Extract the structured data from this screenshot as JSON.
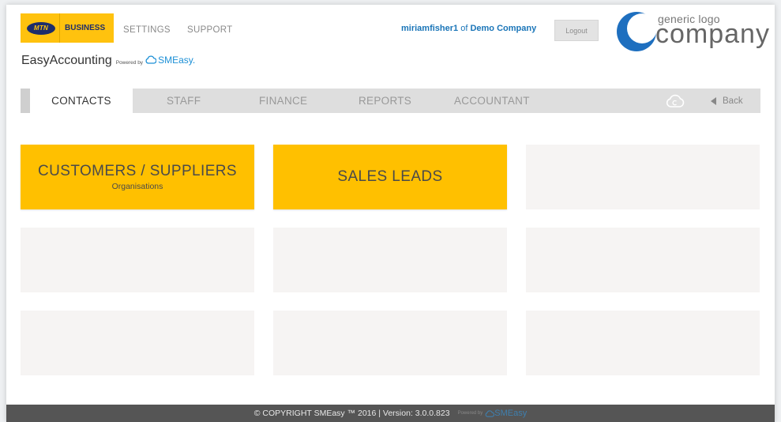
{
  "header": {
    "brand": {
      "mtn": "MTN",
      "business": "BUSINESS"
    },
    "links": {
      "settings": "SETTINGS",
      "support": "SUPPORT"
    },
    "app_name": "EasyAccounting",
    "powered_by": "Powered by",
    "smeasy": "SMEasy.",
    "user": {
      "name": "miriamfisher1",
      "of": "of",
      "company": "Demo Company"
    },
    "logout_label": "Logout",
    "company_logo": {
      "small": "generic logo",
      "big": "company"
    }
  },
  "nav": {
    "tabs": [
      {
        "label": "CONTACTS",
        "active": true
      },
      {
        "label": "STAFF",
        "active": false
      },
      {
        "label": "FINANCE",
        "active": false
      },
      {
        "label": "REPORTS",
        "active": false
      },
      {
        "label": "ACCOUNTANT",
        "active": false
      }
    ],
    "back_label": "Back"
  },
  "tiles": [
    {
      "title": "CUSTOMERS / SUPPLIERS",
      "subtitle": "Organisations"
    },
    {
      "title": "SALES LEADS",
      "subtitle": ""
    }
  ],
  "footer": {
    "copyright": "© COPYRIGHT SMEasy ™ 2016 | Version: 3.0.0.823",
    "powered_by": "Powered by",
    "smeasy": "SMEasy"
  },
  "colors": {
    "tile_active": "#ffc000",
    "tile_empty": "#f6f4f3",
    "nav_bg": "#dedede",
    "link_blue": "#1a75b8",
    "footer_bg": "#555555"
  }
}
